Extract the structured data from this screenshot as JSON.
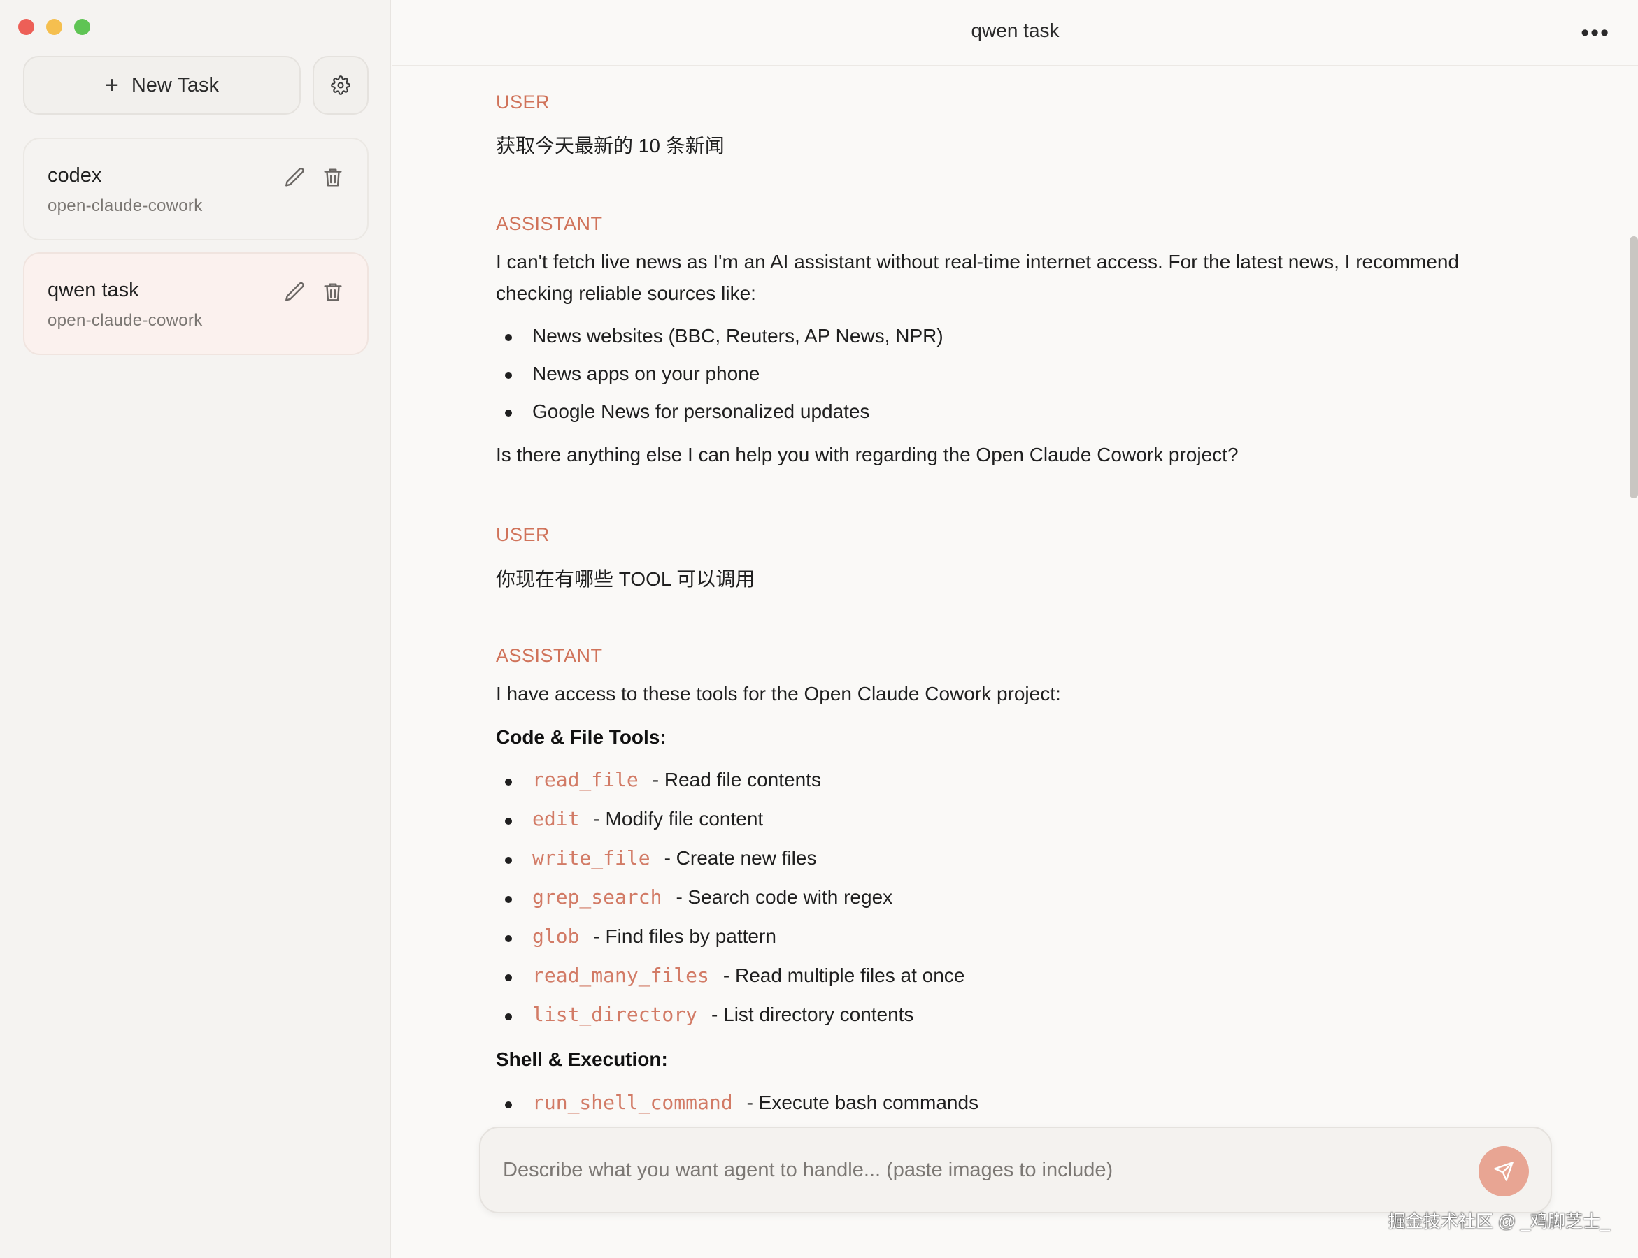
{
  "window": {
    "title": "qwen task"
  },
  "sidebar": {
    "new_task_label": "New Task",
    "sessions": [
      {
        "title": "codex",
        "subtitle": "open-claude-cowork",
        "active": false
      },
      {
        "title": "qwen task",
        "subtitle": "open-claude-cowork",
        "active": true
      }
    ]
  },
  "conversation": {
    "messages": [
      {
        "role": "USER",
        "text": "获取今天最新的 10 条新闻"
      },
      {
        "role": "ASSISTANT",
        "lines": [
          "I can't fetch live news as I'm an AI assistant without real-time internet access. For the latest news, I recommend",
          "checking reliable sources like:"
        ],
        "bullets": [
          "News websites (BBC, Reuters, AP News, NPR)",
          "News apps on your phone",
          "Google News for personalized updates"
        ],
        "closing": "Is there anything else I can help you with regarding the Open Claude Cowork project?"
      },
      {
        "role": "USER",
        "text": "你现在有哪些 TOOL 可以调用"
      },
      {
        "role": "ASSISTANT",
        "intro": "I have access to these tools for the Open Claude Cowork project:",
        "sections": [
          {
            "heading": "Code & File Tools:",
            "tools": [
              {
                "name": "read_file",
                "desc": "- Read file contents"
              },
              {
                "name": "edit",
                "desc": "- Modify file content"
              },
              {
                "name": "write_file",
                "desc": "- Create new files"
              },
              {
                "name": "grep_search",
                "desc": "- Search code with regex"
              },
              {
                "name": "glob",
                "desc": "- Find files by pattern"
              },
              {
                "name": "read_many_files",
                "desc": "- Read multiple files at once"
              },
              {
                "name": "list_directory",
                "desc": "- List directory contents"
              }
            ]
          },
          {
            "heading": "Shell & Execution:",
            "tools": [
              {
                "name": "run_shell_command",
                "desc": "- Execute bash commands"
              }
            ]
          }
        ]
      }
    ]
  },
  "composer": {
    "placeholder": "Describe what you want agent to handle... (paste images to include)",
    "value": ""
  },
  "watermark": "掘金技术社区 @ _鸡脚芝士_",
  "colors": {
    "accent": "#d0735a",
    "send_button": "#e8a593",
    "sidebar_bg": "#f5f3f1",
    "active_session_bg": "#fbf1ee"
  }
}
